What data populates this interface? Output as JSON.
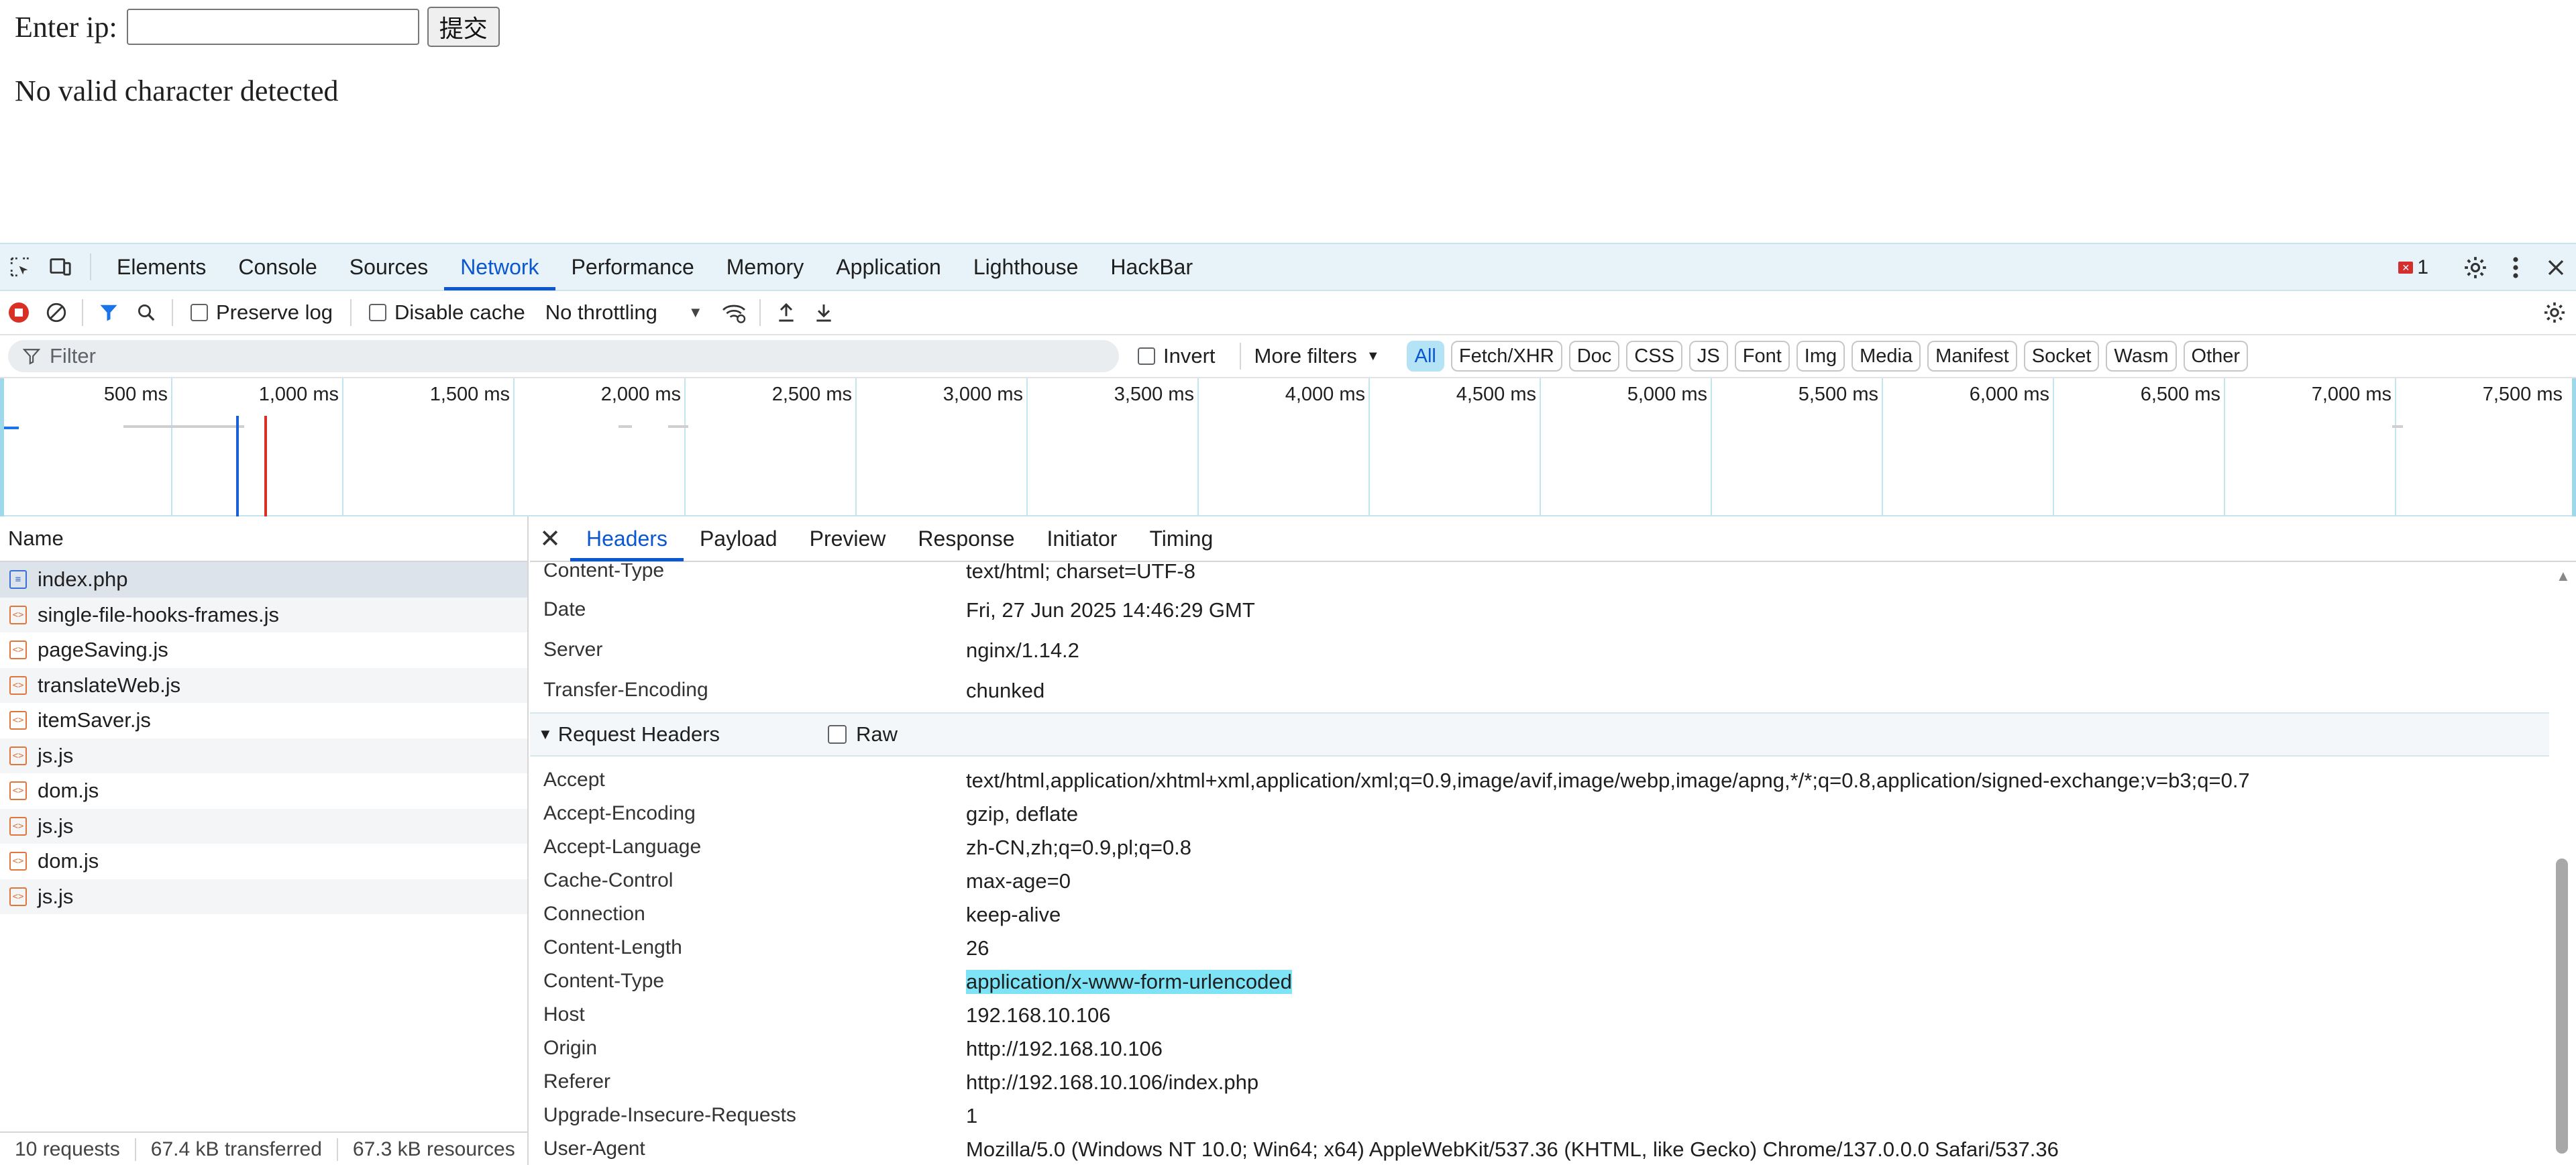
{
  "page": {
    "prompt_label": "Enter ip:",
    "ip_value": "",
    "submit_label": "提交",
    "message": "No valid character detected"
  },
  "devtools": {
    "tabs": [
      "Elements",
      "Console",
      "Sources",
      "Network",
      "Performance",
      "Memory",
      "Application",
      "Lighthouse",
      "HackBar"
    ],
    "active_tab": "Network",
    "error_count": "1",
    "toolbar": {
      "preserve_log": "Preserve log",
      "disable_cache": "Disable cache",
      "throttling": "No throttling"
    },
    "filter": {
      "placeholder": "Filter",
      "invert": "Invert",
      "more_filters": "More filters",
      "chips": [
        "All",
        "Fetch/XHR",
        "Doc",
        "CSS",
        "JS",
        "Font",
        "Img",
        "Media",
        "Manifest",
        "Socket",
        "Wasm",
        "Other"
      ]
    },
    "timeline_ticks": [
      "500 ms",
      "1,000 ms",
      "1,500 ms",
      "2,000 ms",
      "2,500 ms",
      "3,000 ms",
      "3,500 ms",
      "4,000 ms",
      "4,500 ms",
      "5,000 ms",
      "5,500 ms",
      "6,000 ms",
      "6,500 ms",
      "7,000 ms",
      "7,500 ms"
    ],
    "requests": {
      "column": "Name",
      "items": [
        "index.php",
        "single-file-hooks-frames.js",
        "pageSaving.js",
        "translateWeb.js",
        "itemSaver.js",
        "js.js",
        "dom.js",
        "js.js",
        "dom.js",
        "js.js"
      ],
      "status": [
        "10 requests",
        "67.4 kB transferred",
        "67.3 kB resources"
      ]
    },
    "detail": {
      "tabs": [
        "Headers",
        "Payload",
        "Preview",
        "Response",
        "Initiator",
        "Timing"
      ],
      "active_tab": "Headers",
      "response_headers": [
        {
          "name": "Content-Type",
          "value": "text/html; charset=UTF-8"
        },
        {
          "name": "Date",
          "value": "Fri, 27 Jun 2025 14:46:29 GMT"
        },
        {
          "name": "Server",
          "value": "nginx/1.14.2"
        },
        {
          "name": "Transfer-Encoding",
          "value": "chunked"
        }
      ],
      "request_section": "Request Headers",
      "raw_label": "Raw",
      "request_headers": [
        {
          "name": "Accept",
          "value": "text/html,application/xhtml+xml,application/xml;q=0.9,image/avif,image/webp,image/apng,*/*;q=0.8,application/signed-exchange;v=b3;q=0.7"
        },
        {
          "name": "Accept-Encoding",
          "value": "gzip, deflate"
        },
        {
          "name": "Accept-Language",
          "value": "zh-CN,zh;q=0.9,pl;q=0.8"
        },
        {
          "name": "Cache-Control",
          "value": "max-age=0"
        },
        {
          "name": "Connection",
          "value": "keep-alive"
        },
        {
          "name": "Content-Length",
          "value": "26"
        },
        {
          "name": "Content-Type",
          "value": "application/x-www-form-urlencoded"
        },
        {
          "name": "Host",
          "value": "192.168.10.106"
        },
        {
          "name": "Origin",
          "value": "http://192.168.10.106"
        },
        {
          "name": "Referer",
          "value": "http://192.168.10.106/index.php"
        },
        {
          "name": "Upgrade-Insecure-Requests",
          "value": "1"
        },
        {
          "name": "User-Agent",
          "value": "Mozilla/5.0 (Windows NT 10.0; Win64; x64) AppleWebKit/537.36 (KHTML, like Gecko) Chrome/137.0.0.0 Safari/537.36"
        }
      ]
    }
  }
}
